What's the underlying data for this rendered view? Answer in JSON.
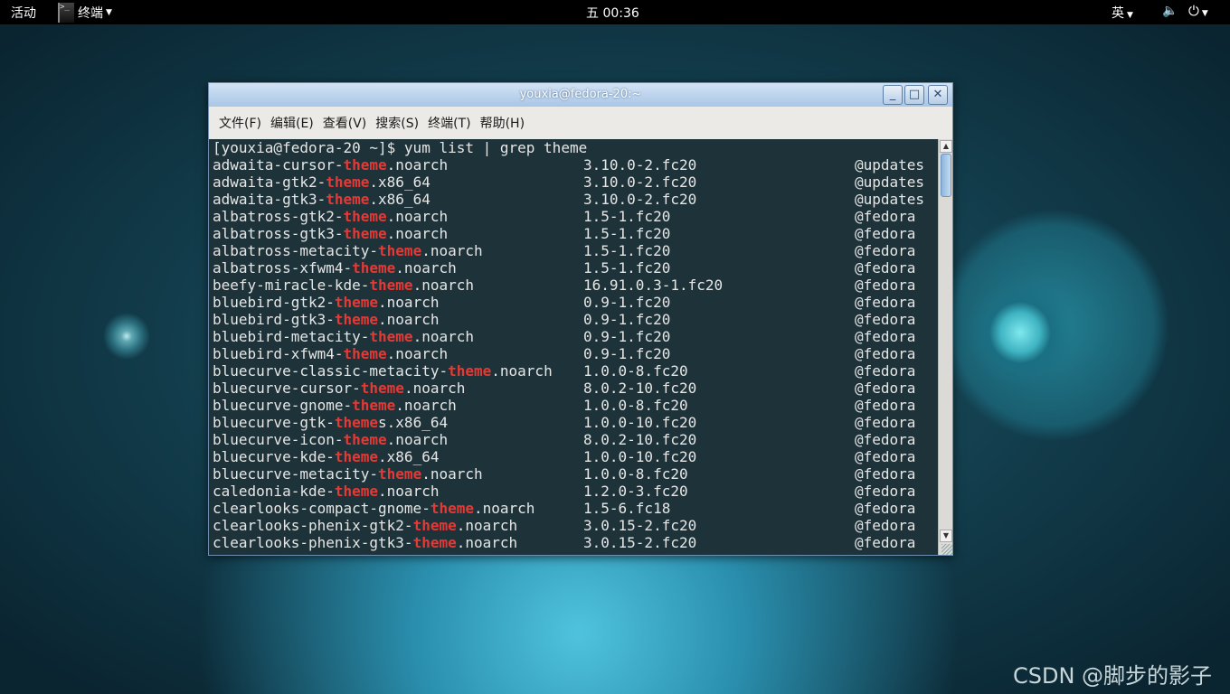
{
  "topbar": {
    "activities": "活动",
    "app_label": "终端",
    "clock": "五 00:36",
    "input_method": "英"
  },
  "window": {
    "title": "youxia@fedora-20:~",
    "menu": [
      "文件(F)",
      "编辑(E)",
      "查看(V)",
      "搜索(S)",
      "终端(T)",
      "帮助(H)"
    ],
    "buttons": {
      "minimize": "_",
      "maximize": "□",
      "close": "✕"
    }
  },
  "terminal": {
    "prompt": "[youxia@fedora-20 ~]$ yum list | grep theme",
    "highlight": "theme",
    "rows": [
      {
        "pre": "adwaita-cursor-",
        "hl": "theme",
        "post": ".noarch",
        "version": "3.10.0-2.fc20",
        "repo": "@updates"
      },
      {
        "pre": "adwaita-gtk2-",
        "hl": "theme",
        "post": ".x86_64",
        "version": "3.10.0-2.fc20",
        "repo": "@updates"
      },
      {
        "pre": "adwaita-gtk3-",
        "hl": "theme",
        "post": ".x86_64",
        "version": "3.10.0-2.fc20",
        "repo": "@updates"
      },
      {
        "pre": "albatross-gtk2-",
        "hl": "theme",
        "post": ".noarch",
        "version": "1.5-1.fc20",
        "repo": "@fedora"
      },
      {
        "pre": "albatross-gtk3-",
        "hl": "theme",
        "post": ".noarch",
        "version": "1.5-1.fc20",
        "repo": "@fedora"
      },
      {
        "pre": "albatross-metacity-",
        "hl": "theme",
        "post": ".noarch",
        "version": "1.5-1.fc20",
        "repo": "@fedora"
      },
      {
        "pre": "albatross-xfwm4-",
        "hl": "theme",
        "post": ".noarch",
        "version": "1.5-1.fc20",
        "repo": "@fedora"
      },
      {
        "pre": "beefy-miracle-kde-",
        "hl": "theme",
        "post": ".noarch",
        "version": "16.91.0.3-1.fc20",
        "repo": "@fedora"
      },
      {
        "pre": "bluebird-gtk2-",
        "hl": "theme",
        "post": ".noarch",
        "version": "0.9-1.fc20",
        "repo": "@fedora"
      },
      {
        "pre": "bluebird-gtk3-",
        "hl": "theme",
        "post": ".noarch",
        "version": "0.9-1.fc20",
        "repo": "@fedora"
      },
      {
        "pre": "bluebird-metacity-",
        "hl": "theme",
        "post": ".noarch",
        "version": "0.9-1.fc20",
        "repo": "@fedora"
      },
      {
        "pre": "bluebird-xfwm4-",
        "hl": "theme",
        "post": ".noarch",
        "version": "0.9-1.fc20",
        "repo": "@fedora"
      },
      {
        "pre": "bluecurve-classic-metacity-",
        "hl": "theme",
        "post": ".noarch",
        "version": "1.0.0-8.fc20",
        "repo": "@fedora"
      },
      {
        "pre": "bluecurve-cursor-",
        "hl": "theme",
        "post": ".noarch",
        "version": "8.0.2-10.fc20",
        "repo": "@fedora"
      },
      {
        "pre": "bluecurve-gnome-",
        "hl": "theme",
        "post": ".noarch",
        "version": "1.0.0-8.fc20",
        "repo": "@fedora"
      },
      {
        "pre": "bluecurve-gtk-",
        "hl": "theme",
        "post": "s.x86_64",
        "version": "1.0.0-10.fc20",
        "repo": "@fedora"
      },
      {
        "pre": "bluecurve-icon-",
        "hl": "theme",
        "post": ".noarch",
        "version": "8.0.2-10.fc20",
        "repo": "@fedora"
      },
      {
        "pre": "bluecurve-kde-",
        "hl": "theme",
        "post": ".x86_64",
        "version": "1.0.0-10.fc20",
        "repo": "@fedora"
      },
      {
        "pre": "bluecurve-metacity-",
        "hl": "theme",
        "post": ".noarch",
        "version": "1.0.0-8.fc20",
        "repo": "@fedora"
      },
      {
        "pre": "caledonia-kde-",
        "hl": "theme",
        "post": ".noarch",
        "version": "1.2.0-3.fc20",
        "repo": "@fedora"
      },
      {
        "pre": "clearlooks-compact-gnome-",
        "hl": "theme",
        "post": ".noarch",
        "version": "1.5-6.fc18",
        "repo": "@fedora"
      },
      {
        "pre": "clearlooks-phenix-gtk2-",
        "hl": "theme",
        "post": ".noarch",
        "version": "3.0.15-2.fc20",
        "repo": "@fedora"
      },
      {
        "pre": "clearlooks-phenix-gtk3-",
        "hl": "theme",
        "post": ".noarch",
        "version": "3.0.15-2.fc20",
        "repo": "@fedora"
      }
    ]
  },
  "watermark": "CSDN @脚步的影子",
  "colors": {
    "highlight": "#e53935",
    "topbar": "#000000",
    "titlebar": "#a9c6e6"
  }
}
